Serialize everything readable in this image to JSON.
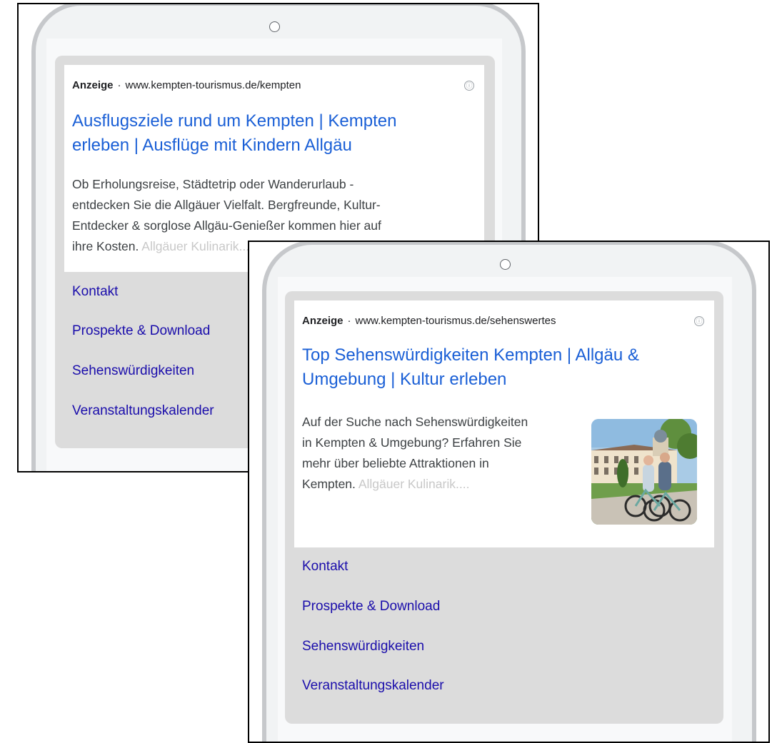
{
  "ads": [
    {
      "label": "Anzeige",
      "separator": "·",
      "url": "www.kempten-tourismus.de/kempten",
      "info_icon": "ⓘ",
      "title_lines": [
        "Ausflugsziele rund um Kempten | Kempten",
        "erleben | Ausflüge mit Kindern Allgäu"
      ],
      "description_lines": [
        "Ob Erholungsreise, Städtetrip oder Wanderurlaub -",
        "entdecken Sie die Allgäuer Vielfalt. Bergfreunde, Kultur-",
        "Entdecker & sorglose Allgäu-Genießer kommen hier auf"
      ],
      "description_last": "ihre Kosten.",
      "description_faded": "Allgäuer Kulinarik....",
      "sitelinks": [
        "Kontakt",
        "Prospekte & Download",
        "Sehenswürdigkeiten",
        "Veranstaltungskalender"
      ]
    },
    {
      "label": "Anzeige",
      "separator": "·",
      "url": "www.kempten-tourismus.de/sehenswertes",
      "info_icon": "ⓘ",
      "title_lines": [
        "Top Sehenswürdigkeiten Kempten | Allgäu &",
        "Umgebung | Kultur erleben"
      ],
      "description_lines": [
        "Auf der Suche nach Sehenswürdigkeiten",
        "in Kempten & Umgebung? Erfahren Sie",
        "mehr über beliebte Attraktionen in"
      ],
      "description_last": "Kempten.",
      "description_faded": "Allgäuer Kulinarik....",
      "sitelinks": [
        "Kontakt",
        "Prospekte & Download",
        "Sehenswürdigkeiten",
        "Veranstaltungskalender"
      ],
      "image_subject": "cyclists-in-front-of-residence-photo"
    }
  ],
  "colors": {
    "title": "#1a5fd6",
    "sitelink": "#1a0dab",
    "card_bg": "#dcdcdc",
    "device_frame": "#c6c8cb"
  }
}
